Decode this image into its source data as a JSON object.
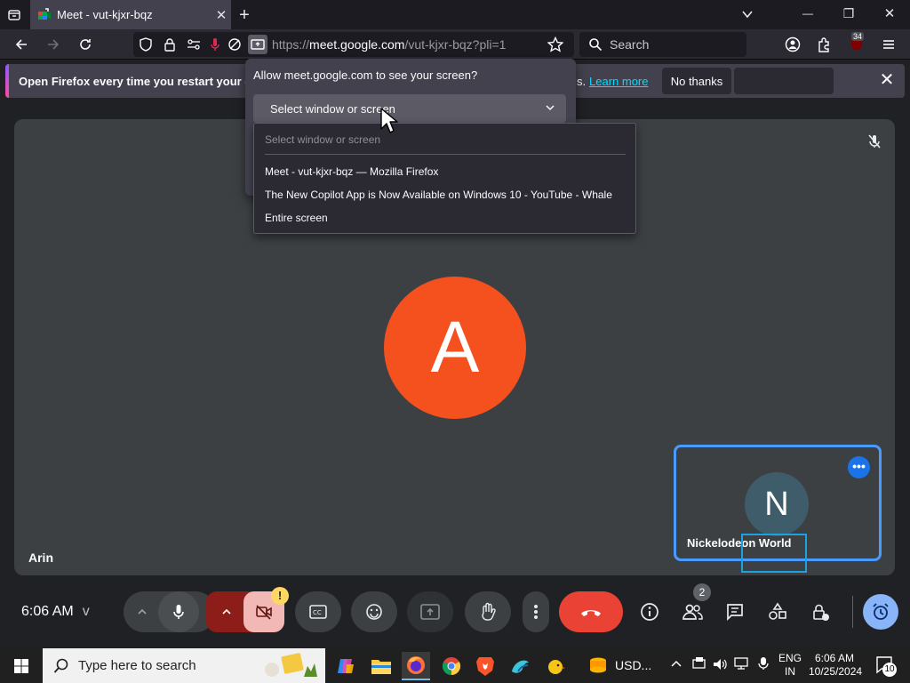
{
  "browser": {
    "tab": {
      "title": "Meet - vut-kjxr-bqz",
      "close": "✕"
    },
    "new_tab": "+",
    "window_controls": {
      "minimize": "—",
      "restore": "❐",
      "close": "✕"
    },
    "url": {
      "scheme": "https://",
      "host": "meet.google.com",
      "path": "/vut-kjxr-bqz?pli=1"
    },
    "search_placeholder": "Search",
    "extension_badge": "34"
  },
  "notification": {
    "message": "Open Firefox every time you restart your com",
    "suffix": "s.",
    "learn_more": "Learn more",
    "no_thanks": "No thanks"
  },
  "share_prompt": {
    "title": "Allow meet.google.com to see your screen?",
    "select_label": "Select window or screen",
    "dropdown": {
      "placeholder": "Select window or screen",
      "options": [
        "Meet - vut-kjxr-bqz — Mozilla Firefox",
        "The New Copilot App is Now Available on Windows 10 - YouTube - Whale",
        "Entire screen"
      ]
    }
  },
  "meet": {
    "main_participant": {
      "initial": "A",
      "name": "Arin",
      "color": "#f4511e"
    },
    "self_tile": {
      "initial": "N",
      "name": "Nickelodeon World",
      "more": "•••"
    },
    "time": "6:06 AM",
    "meeting_code_fragment": "v",
    "camera_warning": "!",
    "people_count": "2"
  },
  "taskbar": {
    "search_placeholder": "Type here to search",
    "app_label": "USD...",
    "lang_line1": "ENG",
    "lang_line2": "IN",
    "time": "6:06 AM",
    "date": "10/25/2024",
    "notifications": "10"
  },
  "colors": {
    "accent": "#1a73e8",
    "hangup": "#ea4335",
    "firefox_link": "#00ddff"
  }
}
